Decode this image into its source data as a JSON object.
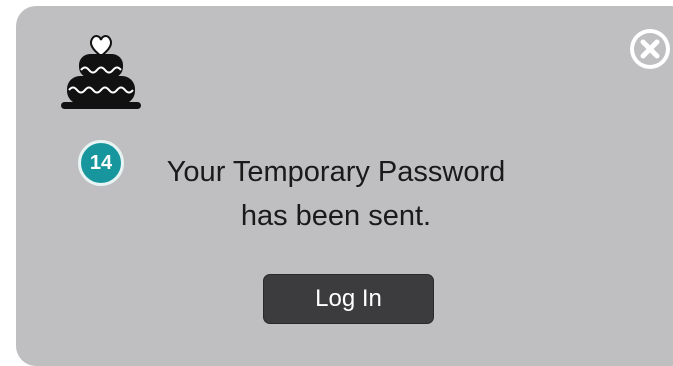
{
  "dialog": {
    "icon": "cake-icon",
    "close_icon": "close-icon",
    "step_number": "14",
    "message_line1": "Your Temporary Password",
    "message_line2": "has been sent.",
    "login_label": "Log In"
  },
  "colors": {
    "dialog_background": "#bfbfc1",
    "badge": "#17979d",
    "button": "#3c3c3e"
  }
}
